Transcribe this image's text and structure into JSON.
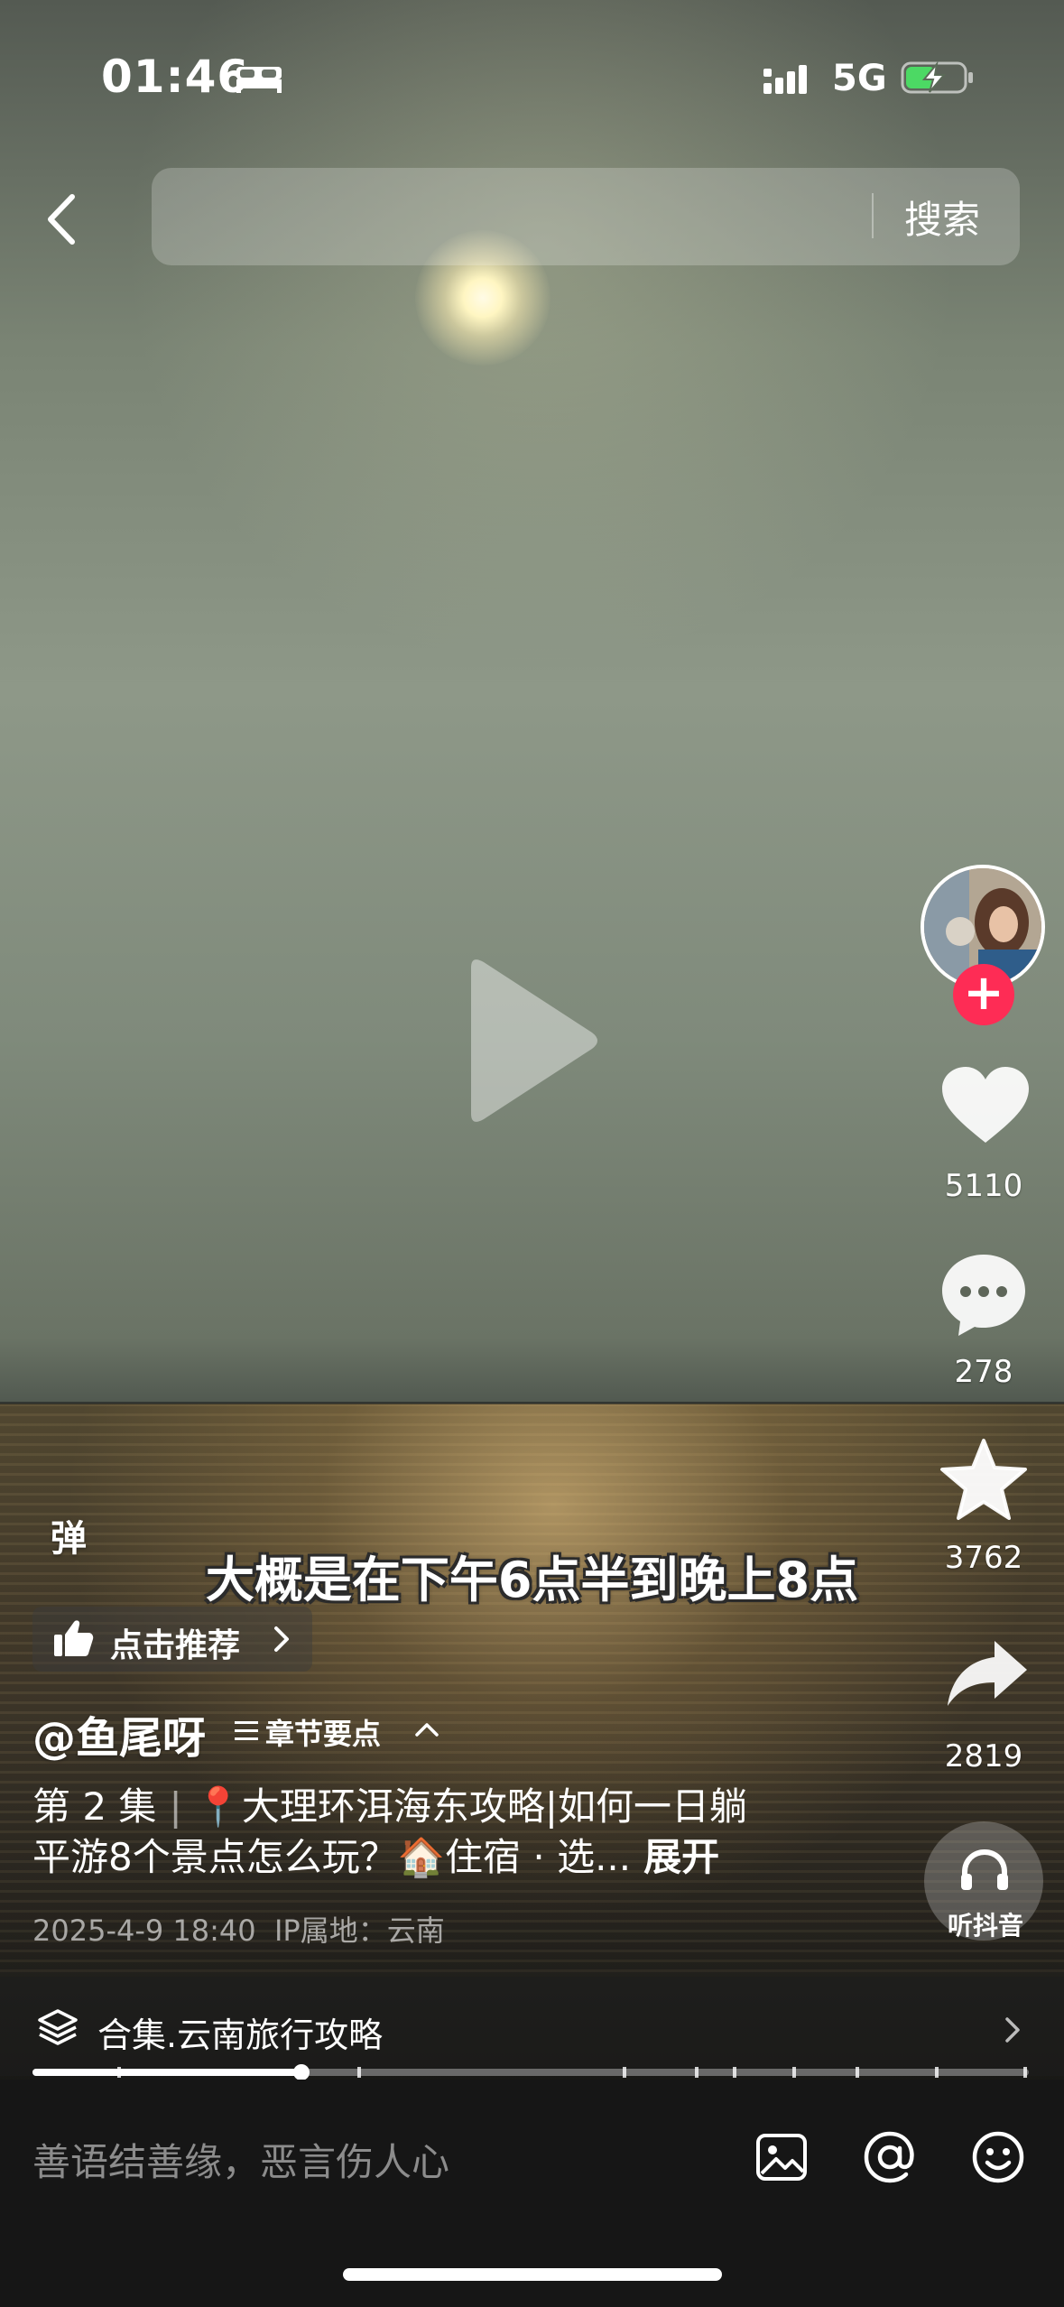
{
  "status_bar": {
    "time": "01:46",
    "network": "5G"
  },
  "search": {
    "button_label": "搜索"
  },
  "rail": {
    "likes": "5110",
    "comments": "278",
    "favorites": "3762",
    "shares": "2819",
    "listen_label": "听抖音"
  },
  "danmaku_label": "弹",
  "subtitle": "大概是在下午6点半到晚上8点",
  "recommend_label": "点击推荐",
  "author": "@鱼尾呀",
  "chapter_label": "章节要点",
  "description": {
    "episode": "第 2 集",
    "pin": "📍",
    "line1": "大理环洱海东攻略|如何一日躺",
    "line2": "平游8个景点怎么玩？",
    "house": "🏠",
    "tail": "住宿 · 选...",
    "expand": "展开"
  },
  "meta": {
    "date": "2025-4-9 18:40",
    "ip": "IP属地：云南"
  },
  "collection": {
    "label": "合集.云南旅行攻略",
    "progress": 0.27
  },
  "comment": {
    "placeholder": "善语结善缘，恶言伤人心"
  },
  "colors": {
    "accent_red": "#fe2c55",
    "bottom_bar": "#161616"
  },
  "icons": [
    "bed-icon",
    "signal-icon",
    "battery-charging-icon",
    "back-icon",
    "play-icon",
    "heart-icon",
    "comment-icon",
    "star-icon",
    "share-icon",
    "headphones-icon",
    "thumb-up-icon",
    "layers-icon",
    "image-icon",
    "at-icon",
    "emoji-icon"
  ]
}
